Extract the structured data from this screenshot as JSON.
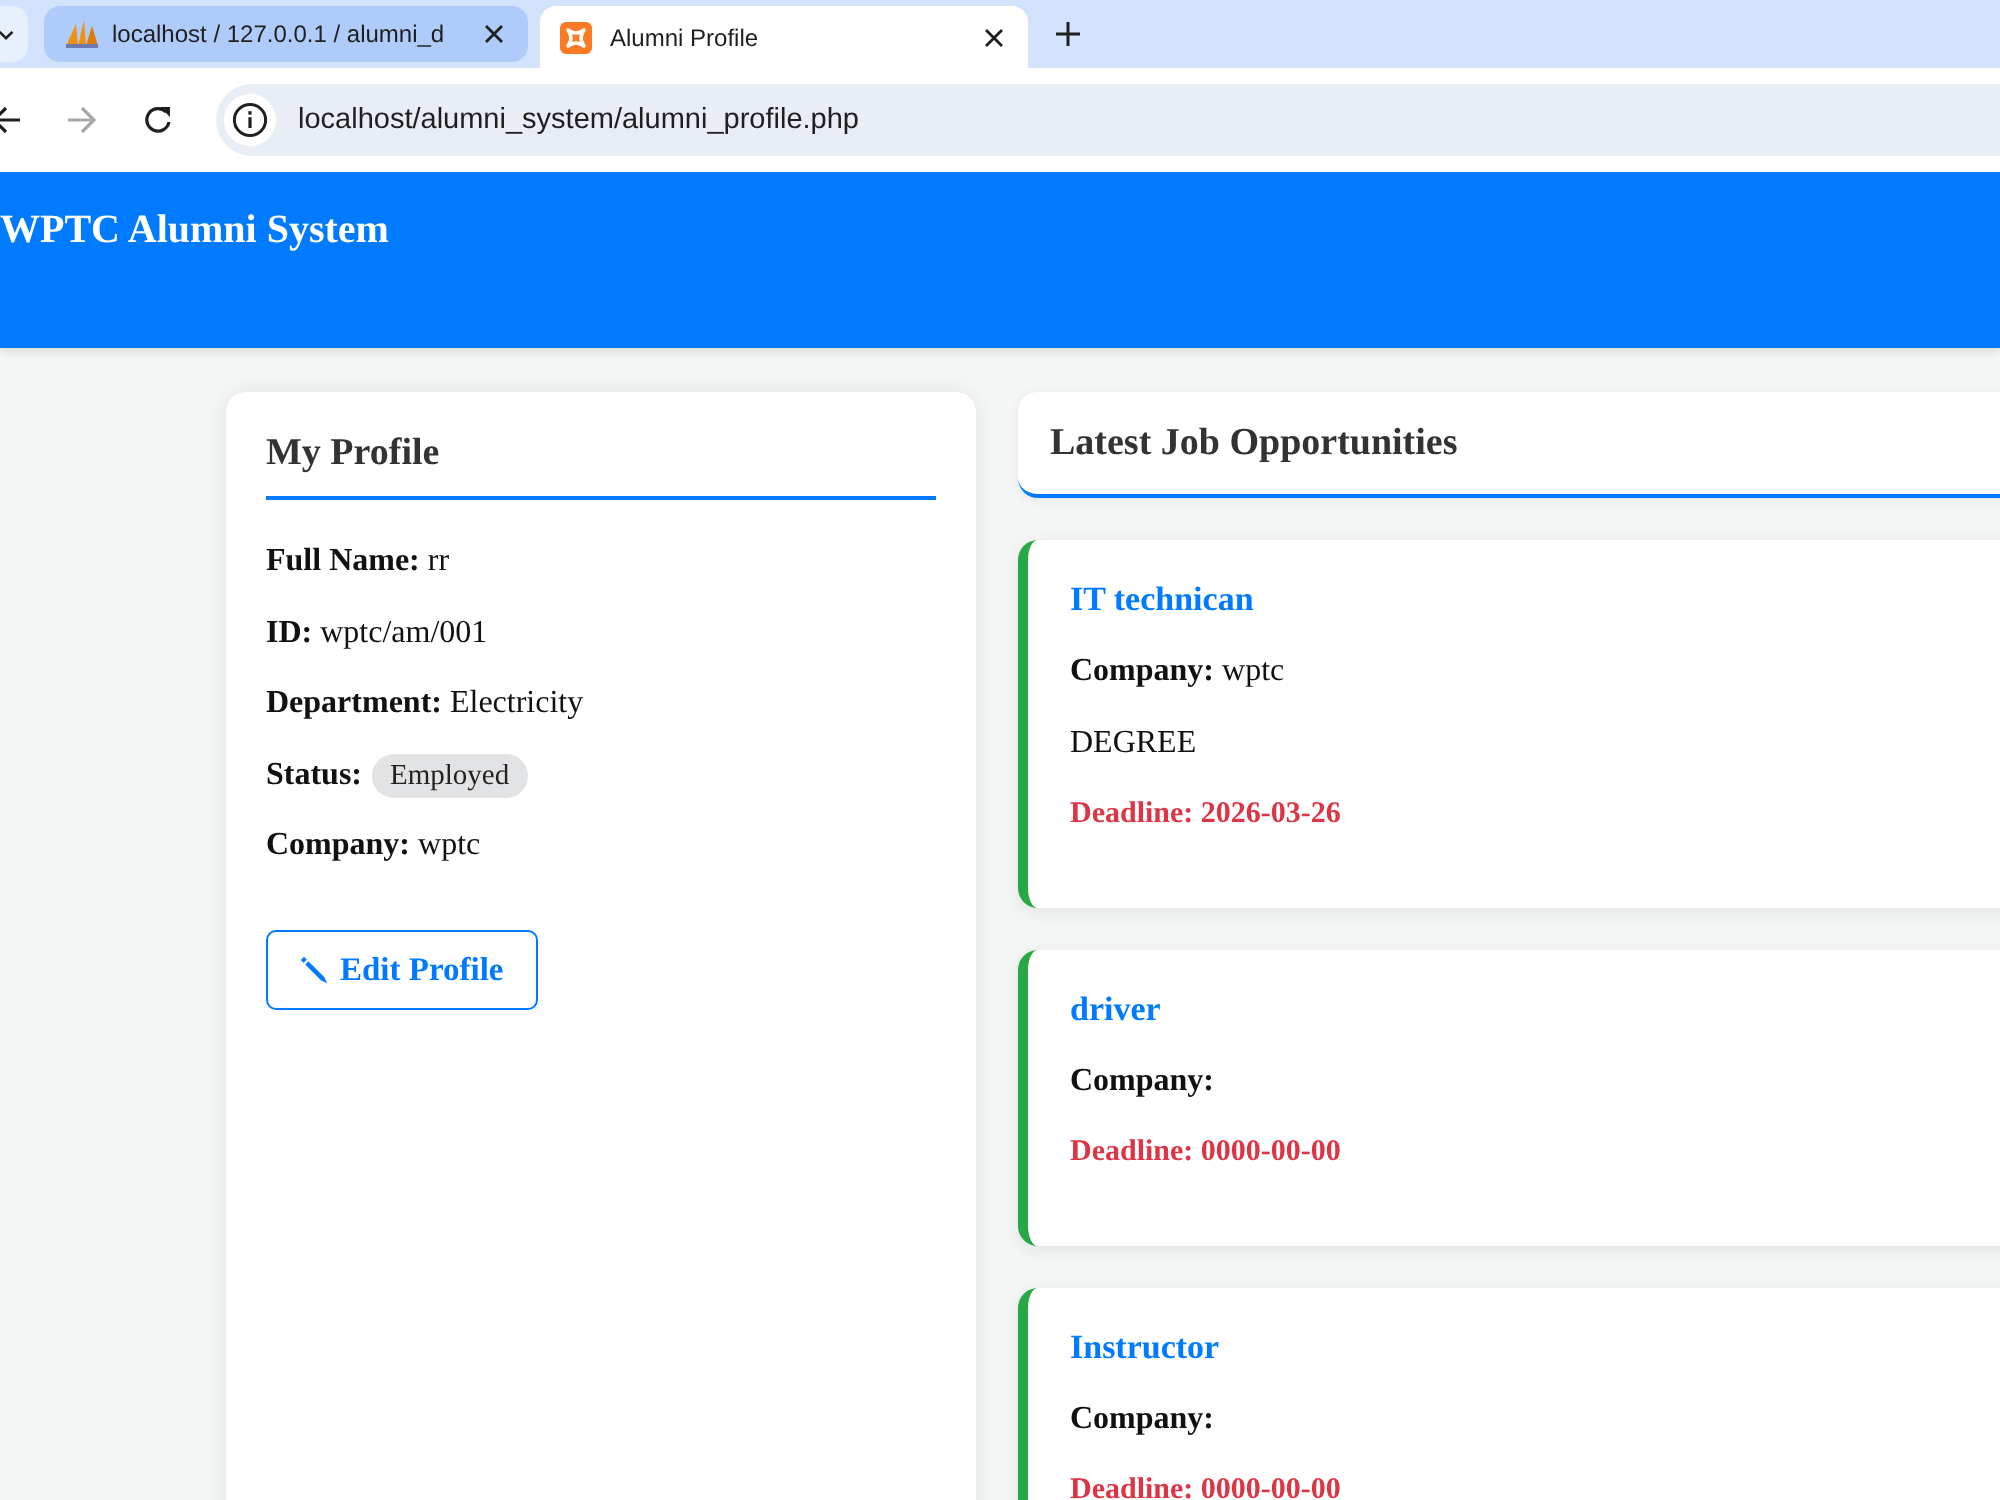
{
  "browser": {
    "tabs": [
      {
        "title": "localhost / 127.0.0.1 / alumni_d",
        "kind": "sails",
        "selected": false
      },
      {
        "title": "Alumni Profile",
        "kind": "tile",
        "selected": true
      }
    ],
    "forward_disabled": true,
    "url": "localhost/alumni_system/alumni_profile.php"
  },
  "header": {
    "title": "WPTC Alumni System"
  },
  "profile": {
    "heading": "My Profile",
    "fields": [
      {
        "kind": "text",
        "label": "Full Name:",
        "value": "rr"
      },
      {
        "kind": "text",
        "label": "ID:",
        "value": "wptc/am/001"
      },
      {
        "kind": "text",
        "label": "Department:",
        "value": "Electricity"
      },
      {
        "kind": "badge",
        "label": "Status:",
        "value": "Employed"
      },
      {
        "kind": "text",
        "label": "Company:",
        "value": "wptc"
      }
    ],
    "edit_button": "Edit Profile"
  },
  "jobs": {
    "heading": "Latest Job Opportunities",
    "items": [
      {
        "title": "IT technican",
        "company_label": "Company:",
        "company": "wptc",
        "details": "DEGREE",
        "deadline": "Deadline: 2026-03-26"
      },
      {
        "title": "driver",
        "company_label": "Company:",
        "deadline": "Deadline: 0000-00-00"
      },
      {
        "title": "Instructor",
        "company_label": "Company:",
        "deadline": "Deadline: 0000-00-00"
      }
    ]
  }
}
